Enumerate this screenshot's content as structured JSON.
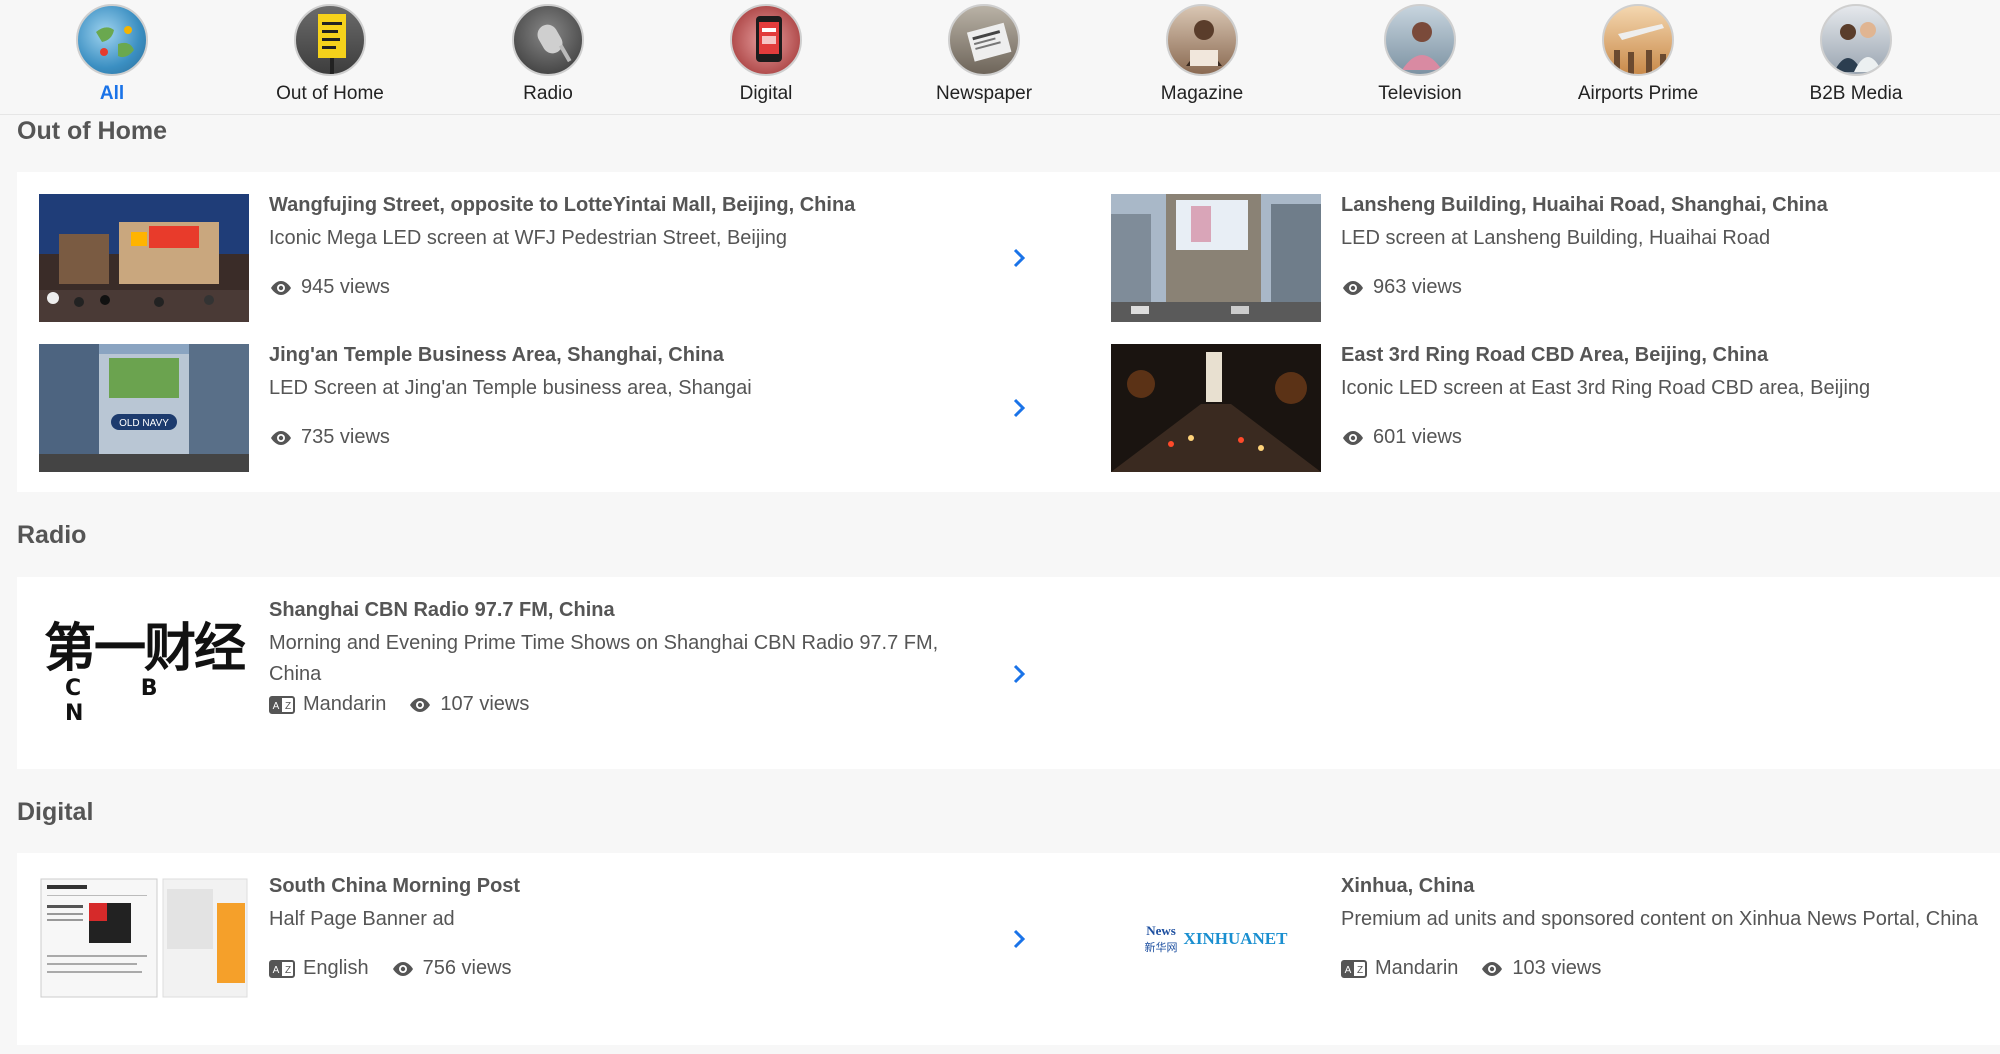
{
  "categories": [
    {
      "label": "All",
      "icon": "globe-icon",
      "active": true
    },
    {
      "label": "Out of Home",
      "icon": "billboard-icon"
    },
    {
      "label": "Radio",
      "icon": "microphone-icon"
    },
    {
      "label": "Digital",
      "icon": "smartphone-icon"
    },
    {
      "label": "Newspaper",
      "icon": "newspaper-icon"
    },
    {
      "label": "Magazine",
      "icon": "magazine-icon"
    },
    {
      "label": "Television",
      "icon": "television-icon"
    },
    {
      "label": "Airports Prime",
      "icon": "airport-icon"
    },
    {
      "label": "B2B Media",
      "icon": "business-icon"
    }
  ],
  "sections": {
    "ooh": {
      "title": "Out of Home",
      "items": [
        {
          "title": "Wangfujing Street, opposite to LotteYintai Mall, Beijing, China",
          "desc": "Iconic Mega LED screen at WFJ Pedestrian Street, Beijing",
          "views": "945 views"
        },
        {
          "title": "Lansheng Building, Huaihai Road, Shanghai, China",
          "desc": "LED screen at Lansheng Building, Huaihai Road",
          "views": "963 views"
        },
        {
          "title": "Jing'an Temple Business Area, Shanghai, China",
          "desc": "LED Screen at Jing'an Temple business area, Shangai",
          "views": "735 views"
        },
        {
          "title": "East 3rd Ring Road CBD Area, Beijing, China",
          "desc": "Iconic LED screen at East 3rd Ring Road CBD area, Beijing",
          "views": "601 views"
        }
      ]
    },
    "radio": {
      "title": "Radio",
      "items": [
        {
          "title": "Shanghai CBN Radio 97.7 FM, China",
          "desc": "Morning and Evening Prime Time Shows on Shanghai CBN Radio 97.7 FM, China",
          "language": "Mandarin",
          "views": "107 views",
          "logo_main": "第一财经",
          "logo_sub": "C B N"
        }
      ]
    },
    "digital": {
      "title": "Digital",
      "items": [
        {
          "title": "South China Morning Post",
          "desc": "Half Page Banner ad",
          "language": "English",
          "views": "756 views"
        },
        {
          "title": "Xinhua, China",
          "desc": "Premium ad units and sponsored content on Xinhua News Portal, China",
          "language": "Mandarin",
          "views": "103 views",
          "logo_text": "XINHUANET",
          "logo_badge": "新华网",
          "logo_news": "News"
        }
      ]
    }
  },
  "colors": {
    "accent": "#1a73e8",
    "text": "#555555",
    "background": "#f7f7f7"
  }
}
